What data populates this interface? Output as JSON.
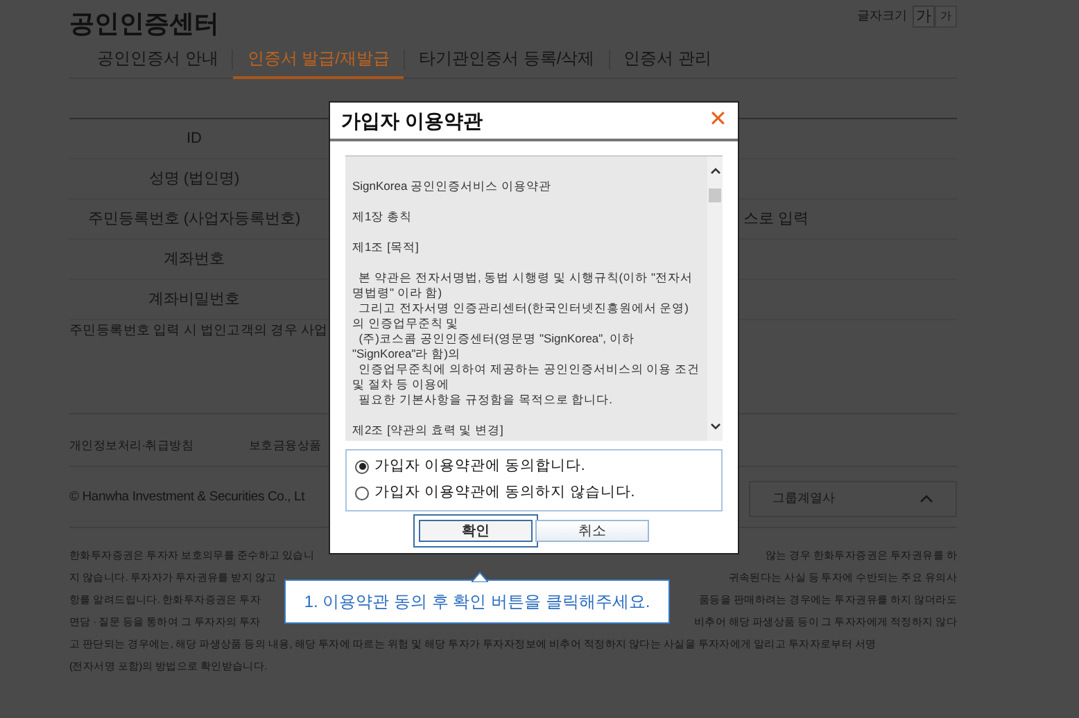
{
  "page": {
    "title": "공인인증센터",
    "font_size_label": "글자크기",
    "font_size_buttons": [
      {
        "label": "가",
        "selected": true
      },
      {
        "label": "가",
        "selected": false
      }
    ]
  },
  "tabs": [
    {
      "label": "공인인증서 안내",
      "selected": false
    },
    {
      "label": "인증서 발급/재발급",
      "selected": true
    },
    {
      "label": "타기관인증서 등록/삭제",
      "selected": false
    },
    {
      "label": "인증서 관리",
      "selected": false
    }
  ],
  "form": {
    "rows": [
      {
        "label": "ID"
      },
      {
        "label": "성명 (법인명)"
      },
      {
        "label": "주민등록번호 (사업자등록번호)",
        "note": "스로 입력"
      },
      {
        "label": "계좌번호"
      },
      {
        "label": "계좌비밀번호"
      }
    ],
    "footnote": "주민등록번호 입력 시 법인고객의 경우 사업"
  },
  "footer": {
    "links": [
      "개인정보처리·취급방침",
      "보호금융상품"
    ],
    "copyright": "© Hanwha Investment & Securities Co., Lt",
    "group_select": "그룹계열사",
    "disclaimer": [
      {
        "left": "한화투자증권은 투자자 보호의무를 준수하고 있습니",
        "right": "않는 경우 한화투자증권은 투자권유를 하"
      },
      {
        "left": "지 않습니다. 투자자가 투자권유를 받지 않고",
        "right": "귀속된다는 사실 등 투자에 수반되는 주요 유의사"
      },
      {
        "left": "항를 알려드립니다. 한화투자증권은 투자",
        "right": "품등을 판매하려는 경우에는 투자권유를 하지 않더라도"
      },
      {
        "left": "면담 · 질문 등을 통하여 그 투자자의 투자",
        "right": "비추어 해당 파생상품 등이 그 투자자에게 적정하지 않다"
      },
      {
        "left": "고 판단되는 경우에는, 해당 파생상품 등의 내용, 해당 투자에 따르는 위험 및 해당 투자가 투자자정보에 비추어 적정하지 않다는 사실을 투자자에게 알리고 투자자로부터 서명"
      },
      {
        "left": "(전자서명 포함)의 방법으로 확인받습니다."
      }
    ]
  },
  "dialog": {
    "title": "가입자 이용약관",
    "close": "✕",
    "terms": [
      [
        "SignKorea 공인인증서비스 이용약관"
      ],
      [
        "제1장 총칙"
      ],
      [
        "제1조 [목적]"
      ],
      [
        "  본 약관은 전자서명법, 동법 시행령 및 시행규칙(이하 \"전자서명법령\" 이라 함)",
        "  그리고 전자서명 인증관리센터(한국인터넷진흥원에서 운영)의 인증업무준칙 및",
        "  (주)코스콤 공인인증센터(영문명 \"SignKorea\", 이하 \"SignKorea\"라 함)의",
        "  인증업무준칙에 의하여 제공하는 공인인증서비스의 이용 조건 및 절차 등 이용에",
        "  필요한 기본사항을 규정함을 목적으로 합니다."
      ],
      [
        "제2조 [약관의 효력 및 변경]"
      ]
    ],
    "options": [
      {
        "label": "가입자 이용약관에 동의합니다.",
        "selected": true
      },
      {
        "label": "가입자 이용약관에 동의하지 않습니다.",
        "selected": false
      }
    ],
    "buttons": [
      {
        "label": "확인",
        "focused": true
      },
      {
        "label": "취소",
        "focused": false
      }
    ]
  },
  "tooltip": "1. 이용약관 동의 후 확인 버튼을 클릭해주세요."
}
